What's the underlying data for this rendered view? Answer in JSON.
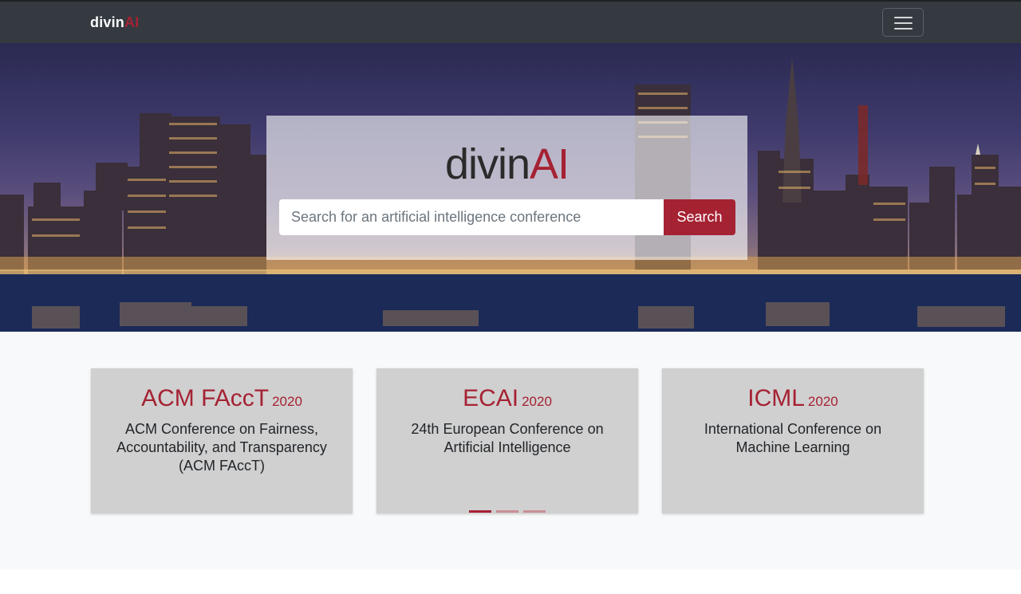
{
  "navbar": {
    "brand_prefix": "divin",
    "brand_suffix": "AI",
    "menu_icon": "hamburger-menu-icon"
  },
  "hero": {
    "background": "city-skyline-at-night-photo",
    "logo_prefix": "divin",
    "logo_suffix": "AI",
    "search": {
      "placeholder": "Search for an artificial intelligence conference",
      "value": "",
      "button_label": "Search"
    }
  },
  "cards": [
    {
      "acronym": "ACM FAccT",
      "year": "2020",
      "description": "ACM Conference on Fairness, Accountability, and Transparency (ACM FAccT)"
    },
    {
      "acronym": "ECAI",
      "year": "2020",
      "description": "24th European Conference on Artificial Intelligence"
    },
    {
      "acronym": "ICML",
      "year": "2020",
      "description": "International Conference on Machine Learning"
    }
  ],
  "carousel": {
    "count": 3,
    "active_index": 0
  },
  "colors": {
    "accent": "#a52233",
    "navbar": "#343a40",
    "card": "#d0d0d0",
    "section_bg": "#f8f9fa"
  }
}
